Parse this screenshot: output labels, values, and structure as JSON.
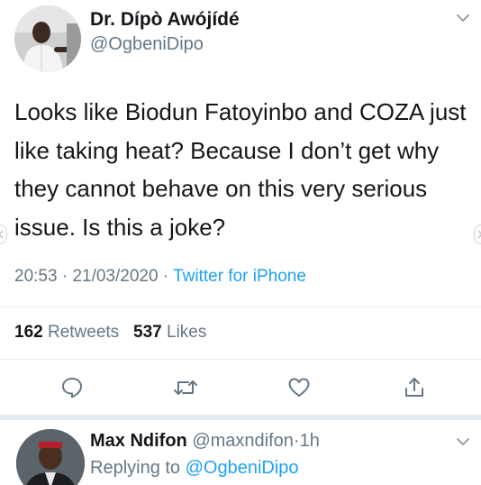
{
  "tweet": {
    "author_name": "Dr. Dípò Awójídé",
    "author_handle": "@OgbeniDipo",
    "text": "Looks like Biodun Fatoyinbo and COZA just like taking heat? Because I don’t get why they cannot behave on this very serious issue. Is this a joke?",
    "time": "20:53",
    "date": "21/03/2020",
    "separator": "·",
    "source": "Twitter for iPhone",
    "retweets_count": "162",
    "retweets_label": "Retweets",
    "likes_count": "537",
    "likes_label": "Likes"
  },
  "icons": {
    "menu": "chevron-down-icon",
    "reply": "comment-icon",
    "retweet": "retweet-icon",
    "like": "heart-icon",
    "share": "share-icon"
  },
  "reply": {
    "author_name": "Max Ndifon",
    "author_handle": "@maxndifon",
    "separator": "·",
    "time_ago": "1h",
    "replying_label": "Replying to",
    "replying_to": "@OgbeniDipo"
  },
  "colors": {
    "text": "#14171a",
    "muted": "#657786",
    "link": "#1da1f2",
    "divider": "#e6ecf0"
  }
}
